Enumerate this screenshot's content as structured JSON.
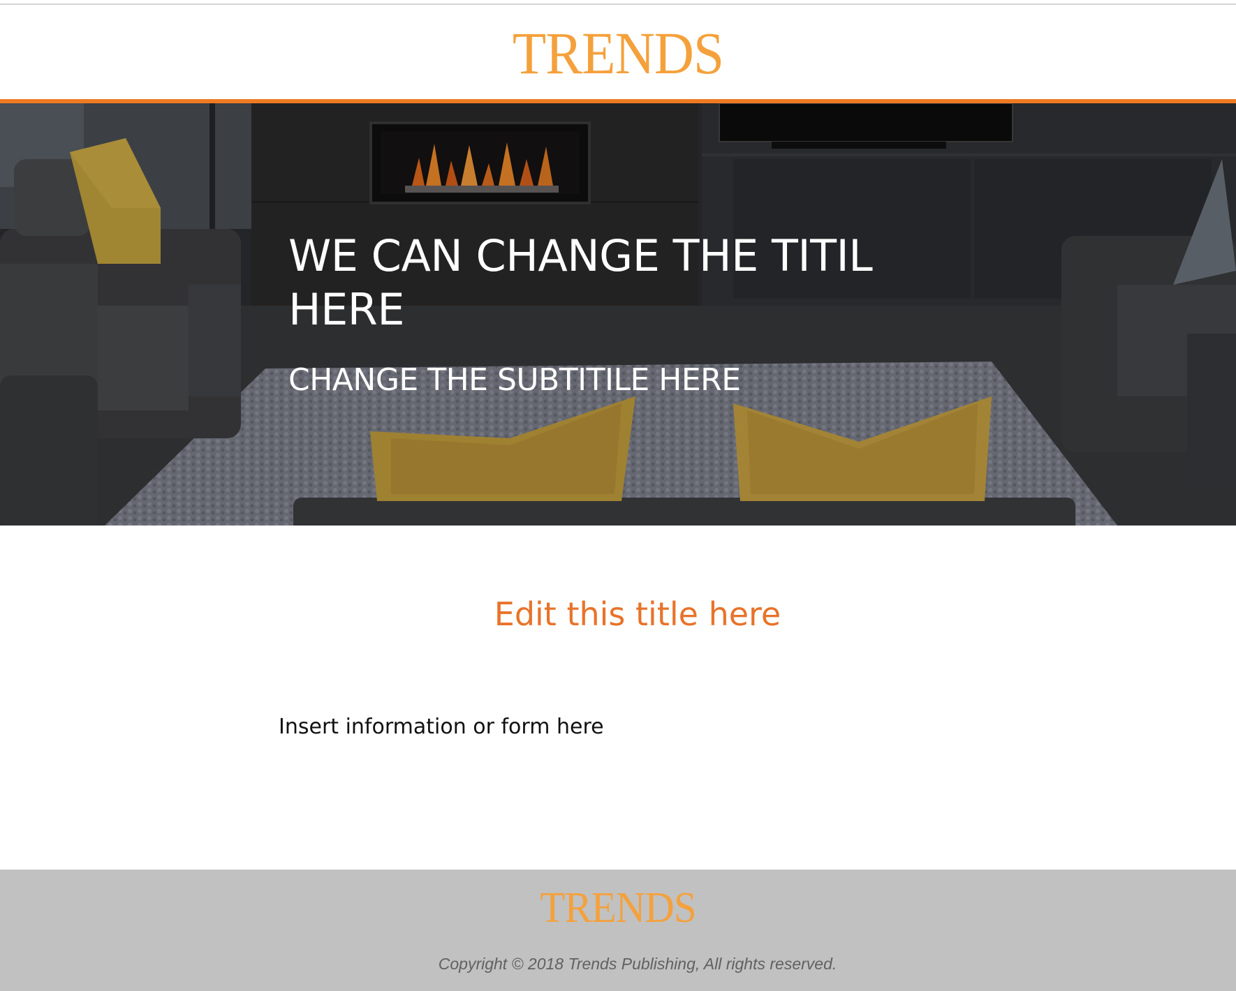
{
  "header": {
    "logo_text": "TRENDS"
  },
  "hero": {
    "title": "WE CAN CHANGE THE TITIL HERE",
    "subtitle": "CHANGE THE SUBTITILE HERE",
    "image_description_icon": "living-room-photo"
  },
  "content": {
    "section_title": "Edit this title here",
    "body_text": "Insert information or form here"
  },
  "footer": {
    "logo_text": "TRENDS",
    "copyright": "Copyright © 2018 Trends Publishing, All rights reserved."
  },
  "colors": {
    "brand_orange": "#f4a13c",
    "accent_bar": "#ee7a22",
    "section_title": "#e8732a",
    "footer_bg": "#c1c1c1",
    "copyright_text": "#616161"
  }
}
